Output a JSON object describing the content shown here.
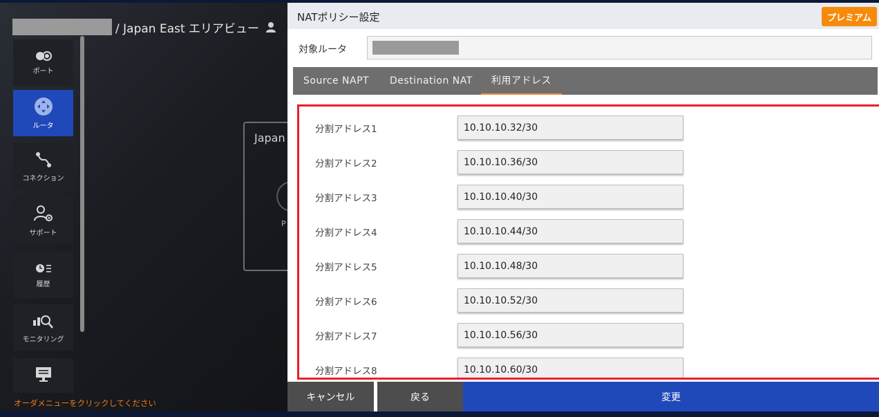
{
  "breadcrumb": {
    "text": "/ Japan East エリアビュー"
  },
  "sidebar": {
    "items": [
      {
        "label": "ポート",
        "icon": "port-icon"
      },
      {
        "label": "ルータ",
        "icon": "router-icon",
        "active": true
      },
      {
        "label": "コネクション",
        "icon": "connection-icon"
      },
      {
        "label": "サポート",
        "icon": "support-icon"
      },
      {
        "label": "履歴",
        "icon": "history-icon"
      },
      {
        "label": "モニタリング",
        "icon": "monitoring-icon"
      },
      {
        "label": "",
        "icon": "order-menu-icon"
      }
    ],
    "hint": "オーダメニューをクリックしてください"
  },
  "background": {
    "card_title": "Japan",
    "card_caption": "P"
  },
  "dialog": {
    "title": "NATポリシー設定",
    "premium_badge": "プレミアム",
    "target_label": "対象ルータ",
    "tabs": [
      {
        "label": "Source NAPT"
      },
      {
        "label": "Destination NAT"
      },
      {
        "label": "利用アドレス",
        "active": true
      }
    ],
    "rows": [
      {
        "label": "分割アドレス1",
        "value": "10.10.10.32/30"
      },
      {
        "label": "分割アドレス2",
        "value": "10.10.10.36/30"
      },
      {
        "label": "分割アドレス3",
        "value": "10.10.10.40/30"
      },
      {
        "label": "分割アドレス4",
        "value": "10.10.10.44/30"
      },
      {
        "label": "分割アドレス5",
        "value": "10.10.10.48/30"
      },
      {
        "label": "分割アドレス6",
        "value": "10.10.10.52/30"
      },
      {
        "label": "分割アドレス7",
        "value": "10.10.10.56/30"
      },
      {
        "label": "分割アドレス8",
        "value": "10.10.10.60/30"
      }
    ],
    "buttons": {
      "cancel": "キャンセル",
      "back": "戻る",
      "change": "変更"
    }
  },
  "colors": {
    "accent_blue": "#1f49b8",
    "premium_orange": "#f68a0a",
    "highlight_red": "#e8202a",
    "hint_orange": "#f07a18"
  }
}
